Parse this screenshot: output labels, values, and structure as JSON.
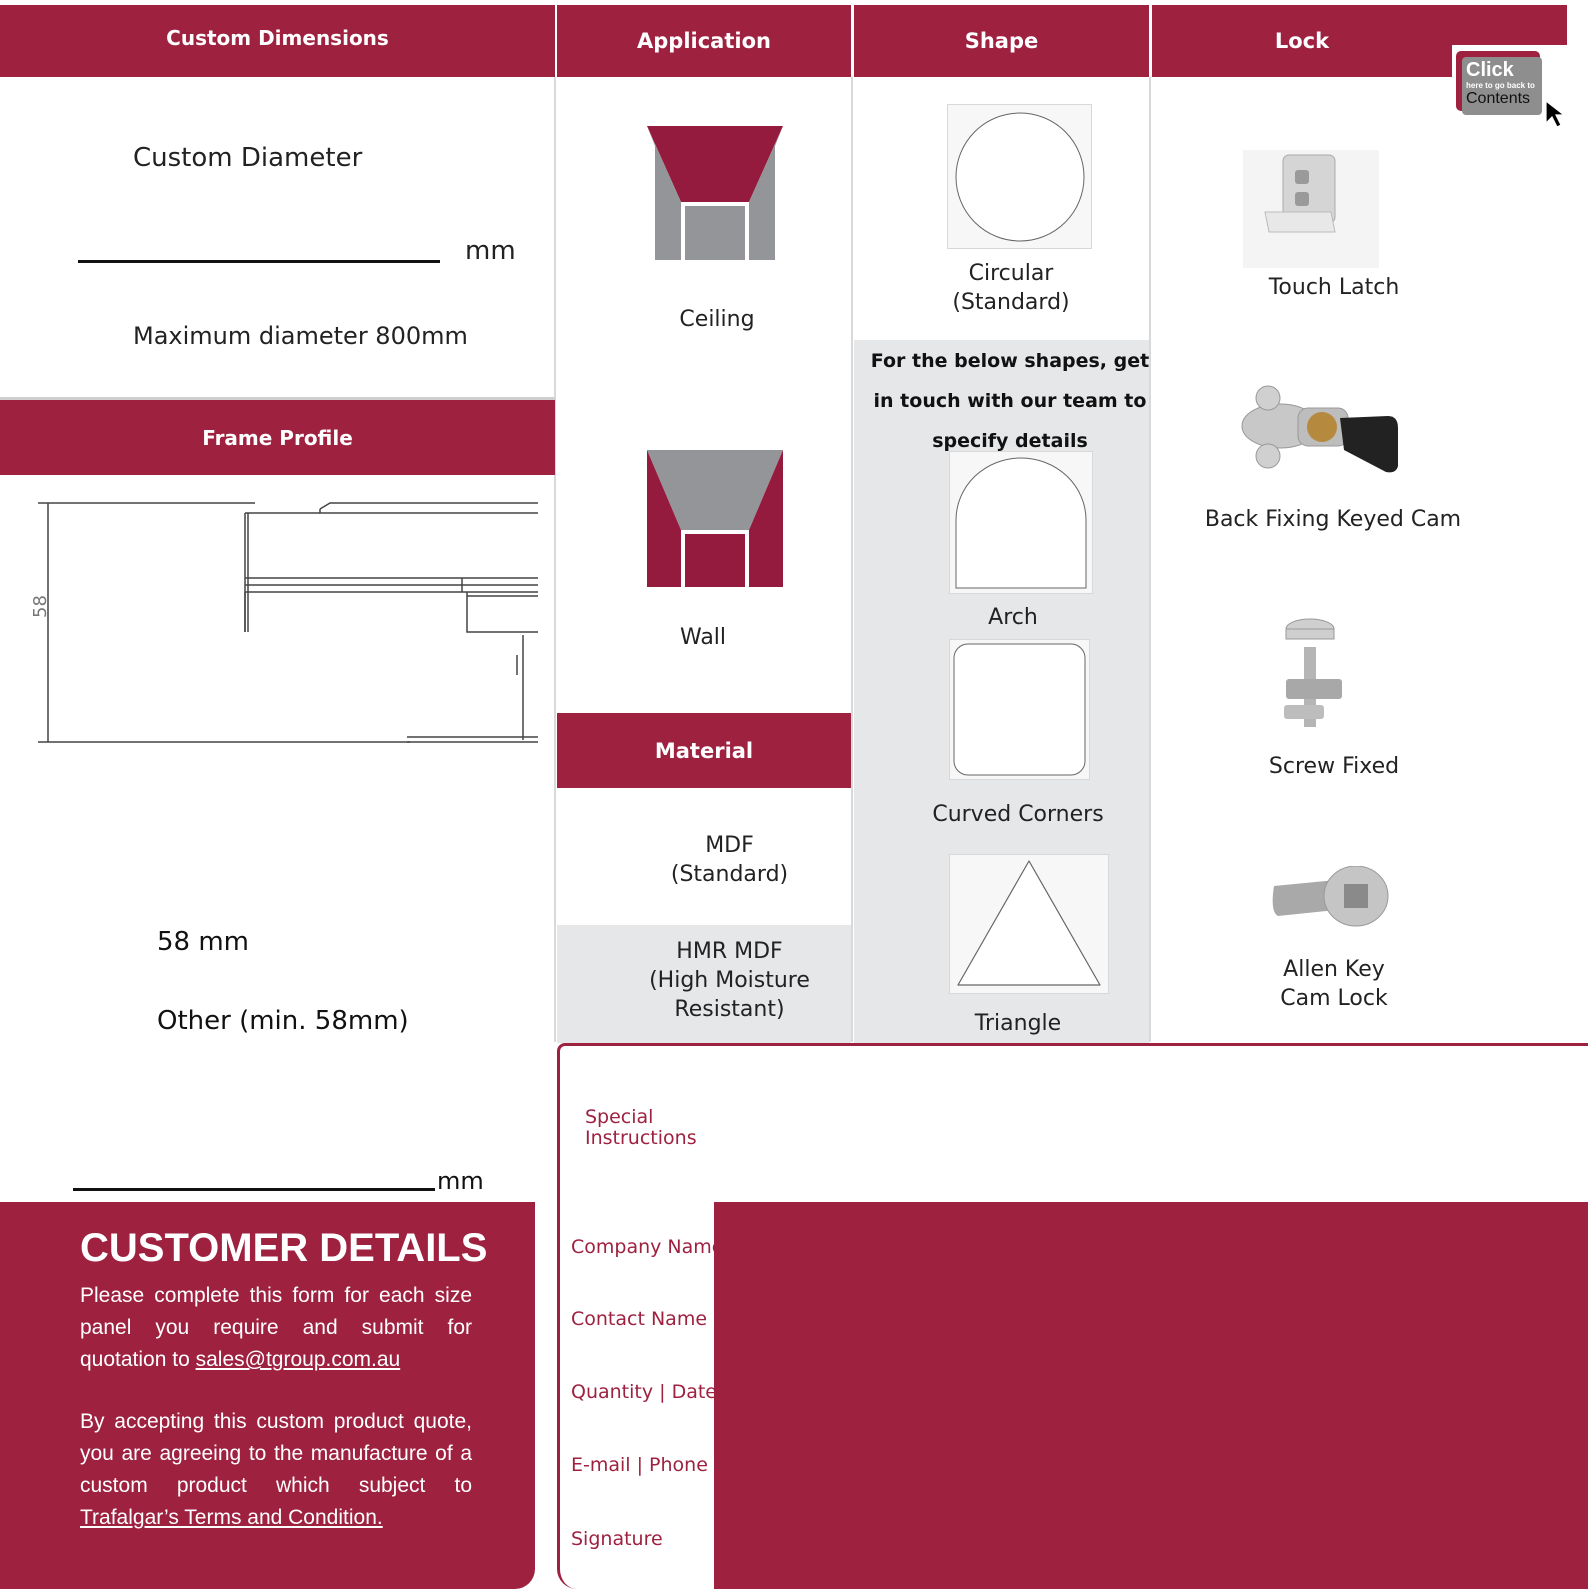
{
  "headers": {
    "custom_dimensions": "Custom Dimensions",
    "application": "Application",
    "shape": "Shape",
    "lock": "Lock",
    "frame_profile": "Frame Profile",
    "material": "Material"
  },
  "custom_dimensions": {
    "diameter_label": "Custom Diameter",
    "diameter_unit": "mm",
    "max_note": "Maximum diameter 800mm"
  },
  "frame_profile": {
    "dimension_label": "58",
    "option_standard": "58 mm",
    "option_other": "Other (min. 58mm)",
    "other_unit": "mm"
  },
  "application": {
    "ceiling": "Ceiling",
    "wall": "Wall"
  },
  "material": {
    "mdf_line1": "MDF",
    "mdf_line2": "(Standard)",
    "hmr_line1": "HMR MDF",
    "hmr_line2": "(High Moisture",
    "hmr_line3": "Resistant)"
  },
  "shape": {
    "circular_line1": "Circular",
    "circular_line2": "(Standard)",
    "note_line1": "For the below shapes, get",
    "note_line2": "in touch with our team to",
    "note_line3": "specify details",
    "arch": "Arch",
    "curved_corners": "Curved Corners",
    "triangle": "Triangle"
  },
  "lock": {
    "touch_latch": "Touch Latch",
    "back_fixing": "Back Fixing Keyed Cam",
    "screw_fixed": "Screw Fixed",
    "allen_line1": "Allen Key",
    "allen_line2": "Cam Lock"
  },
  "contents_button": {
    "line1": "Click",
    "line2": "here to go back to",
    "line3": "Contents"
  },
  "form": {
    "special_line1": "Special",
    "special_line2": "Instructions",
    "company": "Company Name",
    "contact": "Contact Name",
    "quantity": "Quantity | Date",
    "email": "E-mail | Phone",
    "signature": "Signature"
  },
  "customer": {
    "title": "CUSTOMER DETAILS",
    "para1_text": "Please complete this form for each size panel you require and submit for quotation to",
    "email_link": "sales@tgroup.com.au",
    "para2_text": "By accepting this custom product quote, you are agreeing to the manufacture of a custom product which subject to",
    "terms_link": "Trafalgar’s Terms and Condition."
  },
  "colors": {
    "brand": "#9e2140",
    "panel_grey": "#e6e7e9",
    "shape_grey": "#939598"
  }
}
